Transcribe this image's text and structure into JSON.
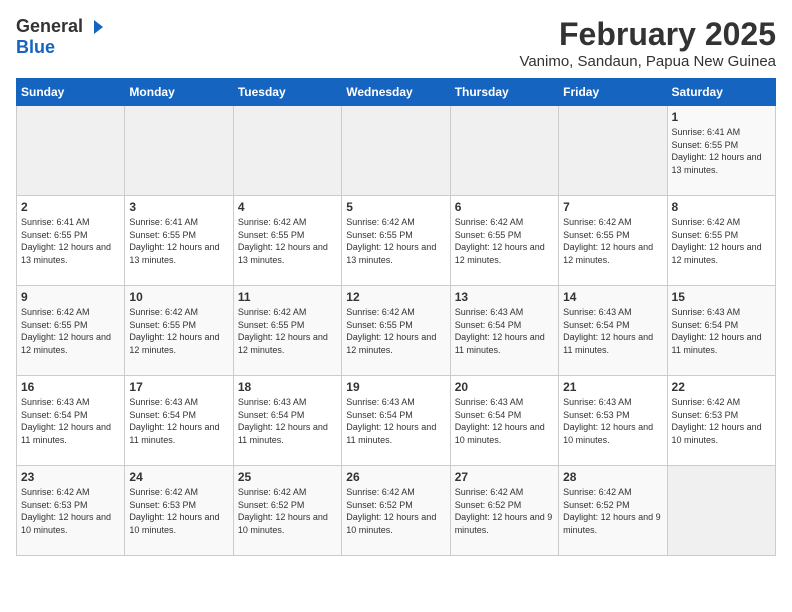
{
  "header": {
    "logo_general": "General",
    "logo_blue": "Blue",
    "month_title": "February 2025",
    "location": "Vanimo, Sandaun, Papua New Guinea"
  },
  "calendar": {
    "days_of_week": [
      "Sunday",
      "Monday",
      "Tuesday",
      "Wednesday",
      "Thursday",
      "Friday",
      "Saturday"
    ],
    "weeks": [
      [
        {
          "day": "",
          "info": ""
        },
        {
          "day": "",
          "info": ""
        },
        {
          "day": "",
          "info": ""
        },
        {
          "day": "",
          "info": ""
        },
        {
          "day": "",
          "info": ""
        },
        {
          "day": "",
          "info": ""
        },
        {
          "day": "1",
          "info": "Sunrise: 6:41 AM\nSunset: 6:55 PM\nDaylight: 12 hours and 13 minutes."
        }
      ],
      [
        {
          "day": "2",
          "info": "Sunrise: 6:41 AM\nSunset: 6:55 PM\nDaylight: 12 hours and 13 minutes."
        },
        {
          "day": "3",
          "info": "Sunrise: 6:41 AM\nSunset: 6:55 PM\nDaylight: 12 hours and 13 minutes."
        },
        {
          "day": "4",
          "info": "Sunrise: 6:42 AM\nSunset: 6:55 PM\nDaylight: 12 hours and 13 minutes."
        },
        {
          "day": "5",
          "info": "Sunrise: 6:42 AM\nSunset: 6:55 PM\nDaylight: 12 hours and 13 minutes."
        },
        {
          "day": "6",
          "info": "Sunrise: 6:42 AM\nSunset: 6:55 PM\nDaylight: 12 hours and 12 minutes."
        },
        {
          "day": "7",
          "info": "Sunrise: 6:42 AM\nSunset: 6:55 PM\nDaylight: 12 hours and 12 minutes."
        },
        {
          "day": "8",
          "info": "Sunrise: 6:42 AM\nSunset: 6:55 PM\nDaylight: 12 hours and 12 minutes."
        }
      ],
      [
        {
          "day": "9",
          "info": "Sunrise: 6:42 AM\nSunset: 6:55 PM\nDaylight: 12 hours and 12 minutes."
        },
        {
          "day": "10",
          "info": "Sunrise: 6:42 AM\nSunset: 6:55 PM\nDaylight: 12 hours and 12 minutes."
        },
        {
          "day": "11",
          "info": "Sunrise: 6:42 AM\nSunset: 6:55 PM\nDaylight: 12 hours and 12 minutes."
        },
        {
          "day": "12",
          "info": "Sunrise: 6:42 AM\nSunset: 6:55 PM\nDaylight: 12 hours and 12 minutes."
        },
        {
          "day": "13",
          "info": "Sunrise: 6:43 AM\nSunset: 6:54 PM\nDaylight: 12 hours and 11 minutes."
        },
        {
          "day": "14",
          "info": "Sunrise: 6:43 AM\nSunset: 6:54 PM\nDaylight: 12 hours and 11 minutes."
        },
        {
          "day": "15",
          "info": "Sunrise: 6:43 AM\nSunset: 6:54 PM\nDaylight: 12 hours and 11 minutes."
        }
      ],
      [
        {
          "day": "16",
          "info": "Sunrise: 6:43 AM\nSunset: 6:54 PM\nDaylight: 12 hours and 11 minutes."
        },
        {
          "day": "17",
          "info": "Sunrise: 6:43 AM\nSunset: 6:54 PM\nDaylight: 12 hours and 11 minutes."
        },
        {
          "day": "18",
          "info": "Sunrise: 6:43 AM\nSunset: 6:54 PM\nDaylight: 12 hours and 11 minutes."
        },
        {
          "day": "19",
          "info": "Sunrise: 6:43 AM\nSunset: 6:54 PM\nDaylight: 12 hours and 11 minutes."
        },
        {
          "day": "20",
          "info": "Sunrise: 6:43 AM\nSunset: 6:54 PM\nDaylight: 12 hours and 10 minutes."
        },
        {
          "day": "21",
          "info": "Sunrise: 6:43 AM\nSunset: 6:53 PM\nDaylight: 12 hours and 10 minutes."
        },
        {
          "day": "22",
          "info": "Sunrise: 6:42 AM\nSunset: 6:53 PM\nDaylight: 12 hours and 10 minutes."
        }
      ],
      [
        {
          "day": "23",
          "info": "Sunrise: 6:42 AM\nSunset: 6:53 PM\nDaylight: 12 hours and 10 minutes."
        },
        {
          "day": "24",
          "info": "Sunrise: 6:42 AM\nSunset: 6:53 PM\nDaylight: 12 hours and 10 minutes."
        },
        {
          "day": "25",
          "info": "Sunrise: 6:42 AM\nSunset: 6:52 PM\nDaylight: 12 hours and 10 minutes."
        },
        {
          "day": "26",
          "info": "Sunrise: 6:42 AM\nSunset: 6:52 PM\nDaylight: 12 hours and 10 minutes."
        },
        {
          "day": "27",
          "info": "Sunrise: 6:42 AM\nSunset: 6:52 PM\nDaylight: 12 hours and 9 minutes."
        },
        {
          "day": "28",
          "info": "Sunrise: 6:42 AM\nSunset: 6:52 PM\nDaylight: 12 hours and 9 minutes."
        },
        {
          "day": "",
          "info": ""
        }
      ]
    ]
  }
}
